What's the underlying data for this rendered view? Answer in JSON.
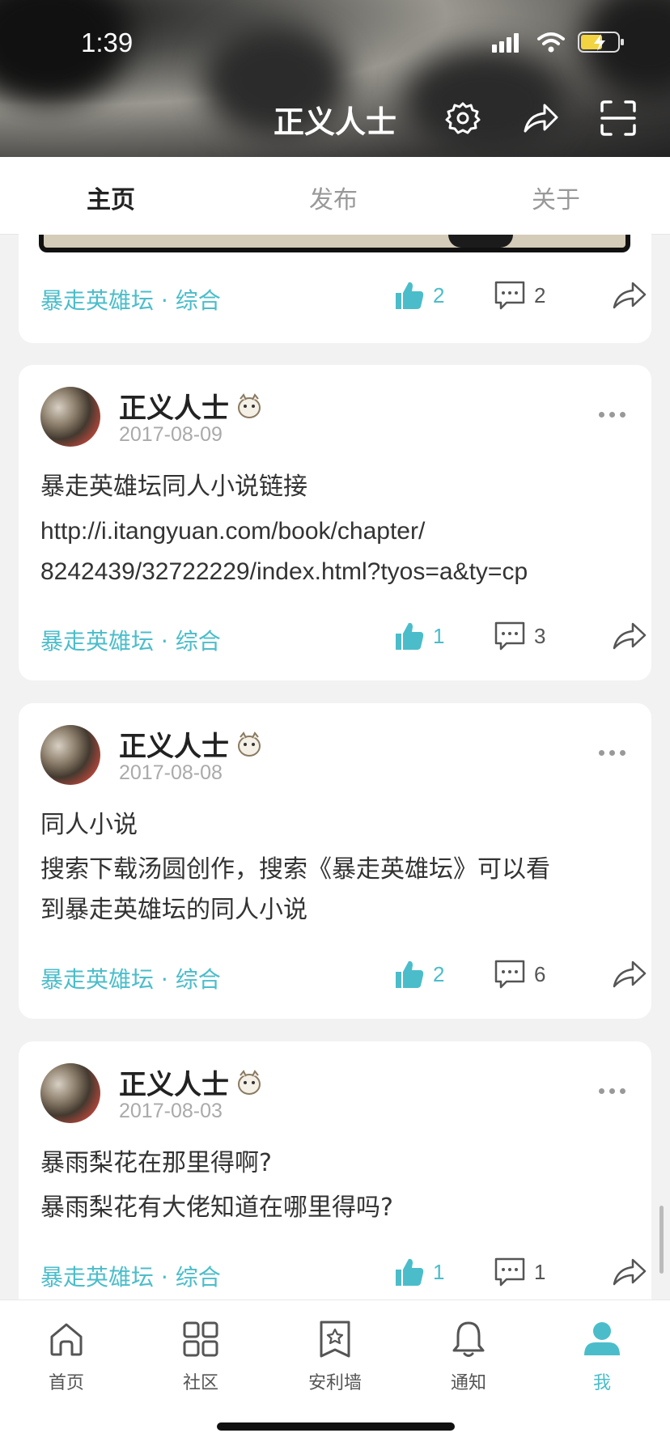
{
  "status": {
    "time": "1:39"
  },
  "header": {
    "title": "正义人士"
  },
  "tabs": [
    {
      "label": "主页"
    },
    {
      "label": "发布"
    },
    {
      "label": "关于"
    }
  ],
  "first_card": {
    "tag": "暴走英雄坛 · 综合",
    "likes": "2",
    "comments": "2"
  },
  "posts": [
    {
      "author": "正义人士",
      "date": "2017-08-09",
      "line1": "暴走英雄坛同人小说链接",
      "line2": "http://i.itangyuan.com/book/chapter/",
      "line3": "8242439/32722229/index.html?tyos=a&ty=cp",
      "tag": "暴走英雄坛 · 综合",
      "likes": "1",
      "comments": "3"
    },
    {
      "author": "正义人士",
      "date": "2017-08-08",
      "line1": "同人小说",
      "line2": "搜索下载汤圆创作，搜索《暴走英雄坛》可以看",
      "line3": "到暴走英雄坛的同人小说",
      "tag": "暴走英雄坛 · 综合",
      "likes": "2",
      "comments": "6"
    },
    {
      "author": "正义人士",
      "date": "2017-08-03",
      "line1": "暴雨梨花在那里得啊?",
      "line2": "暴雨梨花有大佬知道在哪里得吗?",
      "tag": "暴走英雄坛 · 综合",
      "likes": "1",
      "comments": "1"
    }
  ],
  "nav": [
    {
      "label": "首页",
      "icon": "home-icon"
    },
    {
      "label": "社区",
      "icon": "grid-icon"
    },
    {
      "label": "安利墙",
      "icon": "bookmark-star-icon"
    },
    {
      "label": "通知",
      "icon": "bell-icon"
    },
    {
      "label": "我",
      "icon": "person-icon"
    }
  ],
  "colors": {
    "accent": "#4bbdca"
  }
}
